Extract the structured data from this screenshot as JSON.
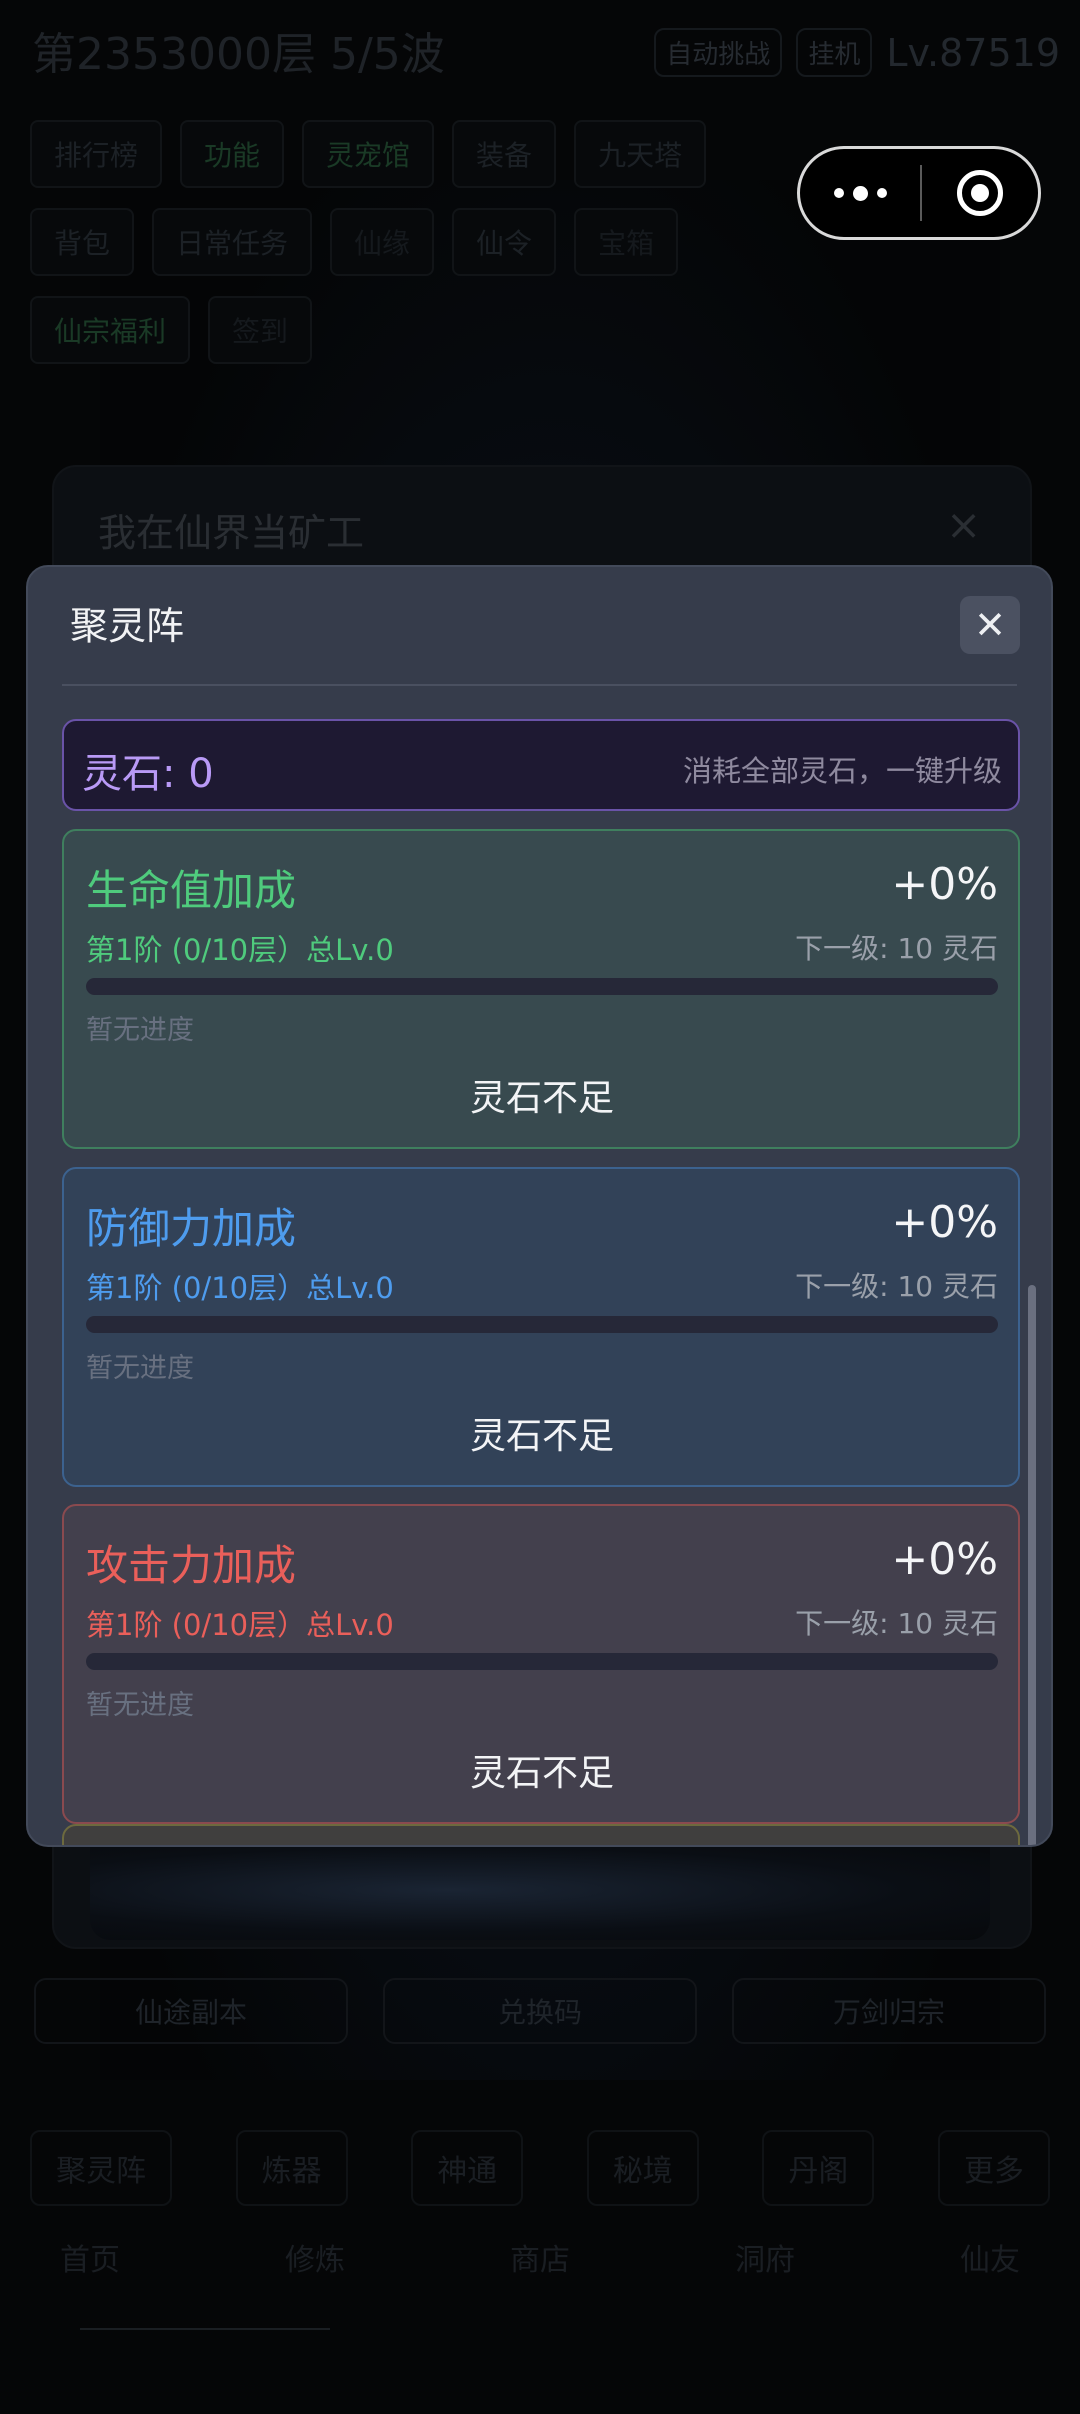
{
  "background": {
    "title": "第2353000层  5/5波",
    "chips": [
      "自动挑战",
      "挂机"
    ],
    "level": "Lv.87519",
    "tabs_row1": [
      "排行榜",
      "功能",
      "灵宠馆",
      "装备",
      "九天塔"
    ],
    "tabs_row2": [
      "背包",
      "日常任务",
      "仙缘",
      "仙令",
      "宝箱"
    ],
    "tabs_row3": [
      "仙宗福利",
      "签到"
    ],
    "panel_title": "我在仙界当矿工",
    "panel_close": "×",
    "buttons": [
      "仙途副本",
      "兑换码",
      "万剑归宗"
    ],
    "nav_row1": [
      "聚灵阵",
      "炼器",
      "神通",
      "秘境",
      "丹阁",
      "更多"
    ],
    "nav_row2": [
      "首页",
      "修炼",
      "商店",
      "洞府",
      "仙友"
    ]
  },
  "capsule": {
    "more_icon": "more-dots-icon",
    "close_icon": "target-close-icon"
  },
  "modal": {
    "title": "聚灵阵",
    "close": "✕",
    "stone": {
      "label": "灵石: 0",
      "action": "消耗全部灵石，一键升级"
    },
    "cards": [
      {
        "name": "生命值加成",
        "percent": "+0%",
        "tier": "第1阶 (0/10层）总Lv.0",
        "next": "下一级: 10 灵石",
        "progress": 0,
        "progress_text": "暂无进度",
        "button": "灵石不足",
        "color": "#4fcb7d"
      },
      {
        "name": "防御力加成",
        "percent": "+0%",
        "tier": "第1阶 (0/10层）总Lv.0",
        "next": "下一级: 10 灵石",
        "progress": 0,
        "progress_text": "暂无进度",
        "button": "灵石不足",
        "color": "#4e9cee"
      },
      {
        "name": "攻击力加成",
        "percent": "+0%",
        "tier": "第1阶 (0/10层）总Lv.0",
        "next": "下一级: 10 灵石",
        "progress": 0,
        "progress_text": "暂无进度",
        "button": "灵石不足",
        "color": "#ea5f5a"
      }
    ]
  }
}
